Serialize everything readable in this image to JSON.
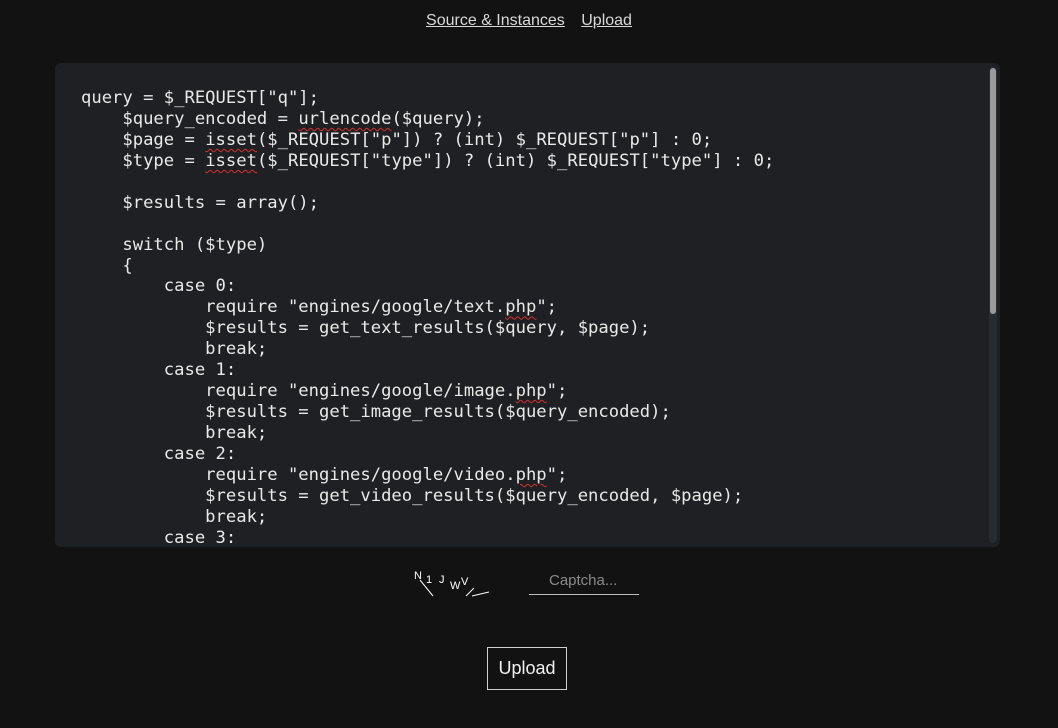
{
  "nav": {
    "source_label": "Source & Instances",
    "upload_label": "Upload"
  },
  "code_lines": [
    [
      "query = $_REQUEST[\"q\"];"
    ],
    [
      "    $query_encoded = ",
      {
        "s": "urlencode"
      },
      "($query);"
    ],
    [
      "    $page = ",
      {
        "s": "isset"
      },
      "($_REQUEST[\"p\"]) ? (int) $_REQUEST[\"p\"] : 0;"
    ],
    [
      "    $type = ",
      {
        "s": "isset"
      },
      "($_REQUEST[\"type\"]) ? (int) $_REQUEST[\"type\"] : 0;"
    ],
    [
      ""
    ],
    [
      "    $results = array();"
    ],
    [
      ""
    ],
    [
      "    switch ($type)"
    ],
    [
      "    {"
    ],
    [
      "        case 0:"
    ],
    [
      "            require \"engines/google/text.",
      {
        "s": "php"
      },
      "\";"
    ],
    [
      "            $results = get_text_results($query, $page);"
    ],
    [
      "            break;"
    ],
    [
      "        case 1:"
    ],
    [
      "            require \"engines/google/image.",
      {
        "s": "php"
      },
      "\";"
    ],
    [
      "            $results = get_image_results($query_encoded);"
    ],
    [
      "            break;"
    ],
    [
      "        case 2:"
    ],
    [
      "            require \"engines/google/video.",
      {
        "s": "php"
      },
      "\";"
    ],
    [
      "            $results = get_video_results($query_encoded, $page);"
    ],
    [
      "            break;"
    ],
    [
      "        case 3:"
    ]
  ],
  "captcha": {
    "image_text": "N1JWV",
    "placeholder": "Captcha..."
  },
  "submit": {
    "label": "Upload"
  },
  "scrollbar": {
    "position_fraction": 0.0,
    "visible_fraction": 0.52
  }
}
